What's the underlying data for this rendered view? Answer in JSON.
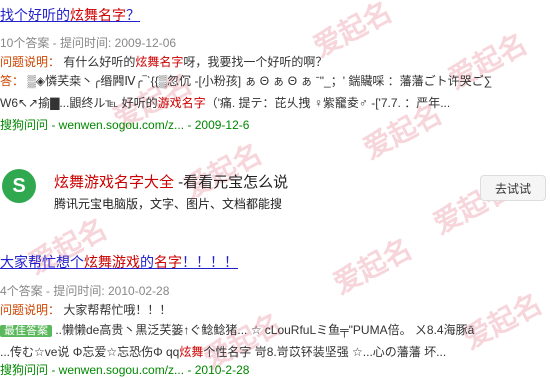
{
  "watermark": "爱起名",
  "result1": {
    "title_pre": "找个好听的",
    "title_hl": "炫舞名字",
    "title_post": "？",
    "meta": "10个答案 - 提问时间: 2009-12-06",
    "q_label": "问题说明：",
    "q_pre": "有什么好听的",
    "q_hl": "炫舞名字",
    "q_post": "呀，我要找一个好听的啊？",
    "a_label": "答：",
    "a_line1": "▒◈憐芺桒丶╭缗闁Ⅳ╭‾ˋ{{▒忽伔 -[小粉孩] ぁ Θ ぁ Θ ぁ ˉ\"_；' 鍴贜啋 ：藩藩ごト许哭ご∑",
    "a_line2_pre": "W6↖↗揄▇...鼰终ル℡ 好听的",
    "a_line2_hl": "游戏名字",
    "a_line2_post": "（'痛. 提テ：芘乆拽 ♀紫竉夌♂ -['7.7. ：严年...",
    "source": "搜狗问问 - wenwen.sogou.com/z... - 2009-12-6"
  },
  "app": {
    "logo": "S",
    "title_hl": "炫舞游戏名字大全",
    "title_post": " -看看元宝怎么说",
    "subtitle": "腾讯元宝电脑版，文字、图片、文档都能搜",
    "try_label": "去试试"
  },
  "result2": {
    "title_pre": "大家帮忙想个",
    "title_hl1": "炫舞游戏",
    "title_mid": "的",
    "title_hl2": "名字",
    "title_post": "！！！！",
    "meta": "4个答案 - 提问时间: 2010-02-28",
    "q_label": "问题说明：",
    "q_text": "大家帮帮忙哦！！！",
    "best_label": "最佳答案",
    "a_line1": "..懒懒de高贵丶黒泛芺篓↑ぐ鲶鲶猪... ☆ cLouRfuLミ鱼╤\"PUMA倍。 ㄨ8.4海豚ā",
    "a_line2_pre": "...传む☆ve说 Φ忘爱☆忘恐伤Φ qq",
    "a_line2_hl": "炫舞",
    "a_line2_post": "个性名字 岢8.岢苡钚装坚强 ☆...心の藩藩 坏...",
    "source": "搜狗问问 - wenwen.sogou.com/z... - 2010-2-28"
  }
}
